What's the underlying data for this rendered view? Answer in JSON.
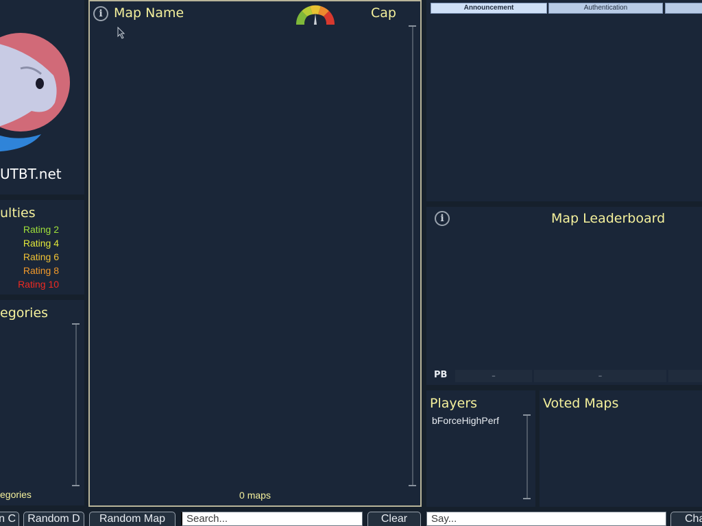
{
  "sidebar": {
    "site_name": "UTBT.net",
    "difficulties": {
      "title": "ulties",
      "ratings": [
        {
          "label": "Rating 2",
          "color": "#9fe03a"
        },
        {
          "label": "Rating 4",
          "color": "#e2e83a"
        },
        {
          "label": "Rating 6",
          "color": "#f0c234"
        },
        {
          "label": "Rating 8",
          "color": "#f39a2a"
        },
        {
          "label": "Rating 10",
          "color": "#ef2a22"
        }
      ]
    },
    "categories": {
      "title": "egories",
      "footer": "egories"
    }
  },
  "map_list": {
    "info_icon": "info-icon",
    "name_header": "Map Name",
    "cap_header": "Cap",
    "count_label": "0 maps"
  },
  "tabs": [
    {
      "label": "Announcement",
      "active": true
    },
    {
      "label": "Authentication",
      "active": false
    },
    {
      "label": "",
      "active": false
    }
  ],
  "leaderboard": {
    "title": "Map Leaderboard",
    "pb_label": "PB",
    "cells": [
      "–",
      "–",
      ""
    ]
  },
  "players": {
    "title": "Players",
    "list": [
      "bForceHighPerf"
    ]
  },
  "voted_maps": {
    "title": "Voted Maps"
  },
  "bottom_bar": {
    "random_c": "n C",
    "random_d": "Random D",
    "random_map": "Random Map",
    "search_placeholder": "Search...",
    "clear": "Clear",
    "say_placeholder": "Say...",
    "chat_button": "Cha"
  },
  "colors": {
    "background": "#16202c",
    "panel": "#1a2638",
    "header_yellow": "#f5f19c",
    "tab_active": "#cfe0f7",
    "tab_inactive": "#b8cbe6"
  }
}
